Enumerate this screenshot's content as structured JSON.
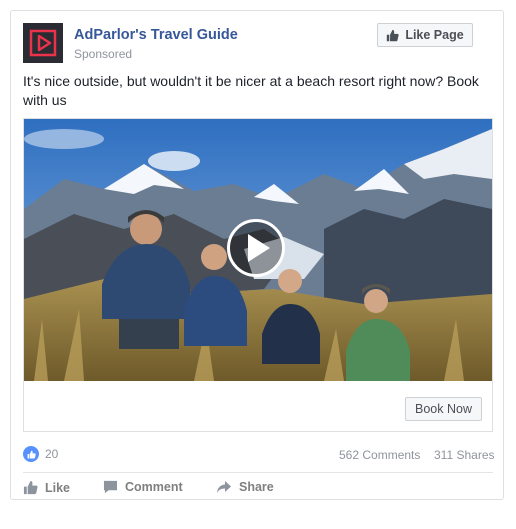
{
  "post": {
    "page_name": "AdParlor's Travel Guide",
    "sponsored_label": "Sponsored",
    "like_page_label": "Like Page",
    "text": "It's nice outside, but wouldn't it be nicer at a beach resort right now? Book with us"
  },
  "attachment": {
    "cta_label": "Book Now"
  },
  "stats": {
    "reactions": "20",
    "comments": "562 Comments",
    "shares": "311 Shares"
  },
  "actions": {
    "like": "Like",
    "comment": "Comment",
    "share": "Share"
  },
  "colors": {
    "link_blue": "#365899",
    "like_blue": "#5890ff",
    "logo_bg": "#2b2b33",
    "logo_accent": "#e8334a"
  }
}
